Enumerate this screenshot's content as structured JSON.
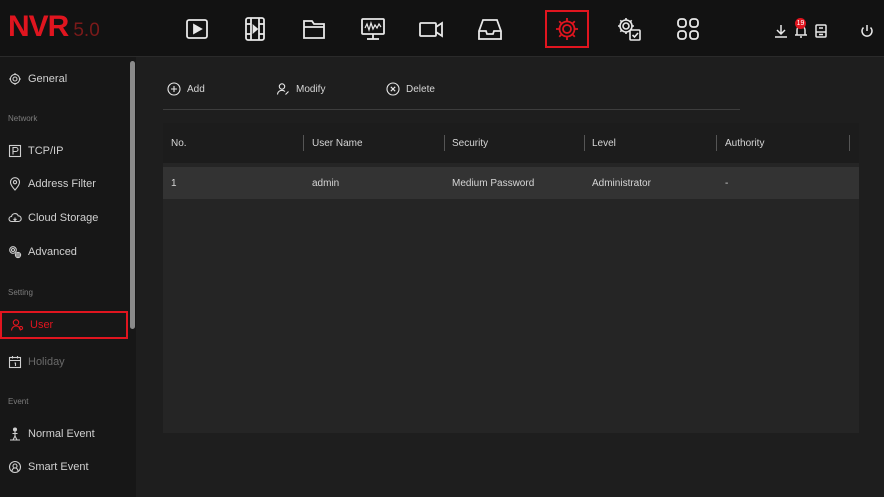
{
  "app": {
    "brand": "NVR",
    "version": "5.0"
  },
  "topnav": {
    "items": [
      {
        "name": "playback-icon"
      },
      {
        "name": "video-clip-icon"
      },
      {
        "name": "file-icon"
      },
      {
        "name": "monitor-icon"
      },
      {
        "name": "camera-icon"
      },
      {
        "name": "storage-icon"
      },
      {
        "name": "settings-icon",
        "active": true
      },
      {
        "name": "system-config-icon"
      },
      {
        "name": "grid-icon"
      }
    ],
    "right": {
      "download": "download-icon",
      "alarm": "alarm-bell-icon",
      "alarm_badge": "19",
      "backup": "backup-icon",
      "power": "power-icon"
    }
  },
  "sidebar": {
    "items": [
      {
        "label": "General",
        "icon": "gear-icon"
      },
      {
        "group": "Network"
      },
      {
        "label": "TCP/IP",
        "icon": "p-box-icon"
      },
      {
        "label": "Address Filter",
        "icon": "location-icon"
      },
      {
        "label": "Cloud Storage",
        "icon": "cloud-icon"
      },
      {
        "label": "Advanced",
        "icon": "advanced-gear-icon"
      },
      {
        "group": "Setting"
      },
      {
        "label": "User",
        "icon": "user-icon",
        "active": true
      },
      {
        "label": "Holiday",
        "icon": "calendar-icon",
        "dim": true
      },
      {
        "group": "Event"
      },
      {
        "label": "Normal Event",
        "icon": "person-alert-icon"
      },
      {
        "label": "Smart Event",
        "icon": "smart-event-icon"
      }
    ]
  },
  "toolbar": {
    "add_label": "Add",
    "modify_label": "Modify",
    "delete_label": "Delete"
  },
  "table": {
    "columns": [
      "No.",
      "User Name",
      "Security",
      "Level",
      "Authority"
    ],
    "rows": [
      [
        "1",
        "admin",
        "Medium Password",
        "Administrator",
        "-"
      ]
    ]
  },
  "colors": {
    "accent": "#e0151f",
    "background": "#1e1e1e",
    "row_selected": "#333333"
  }
}
